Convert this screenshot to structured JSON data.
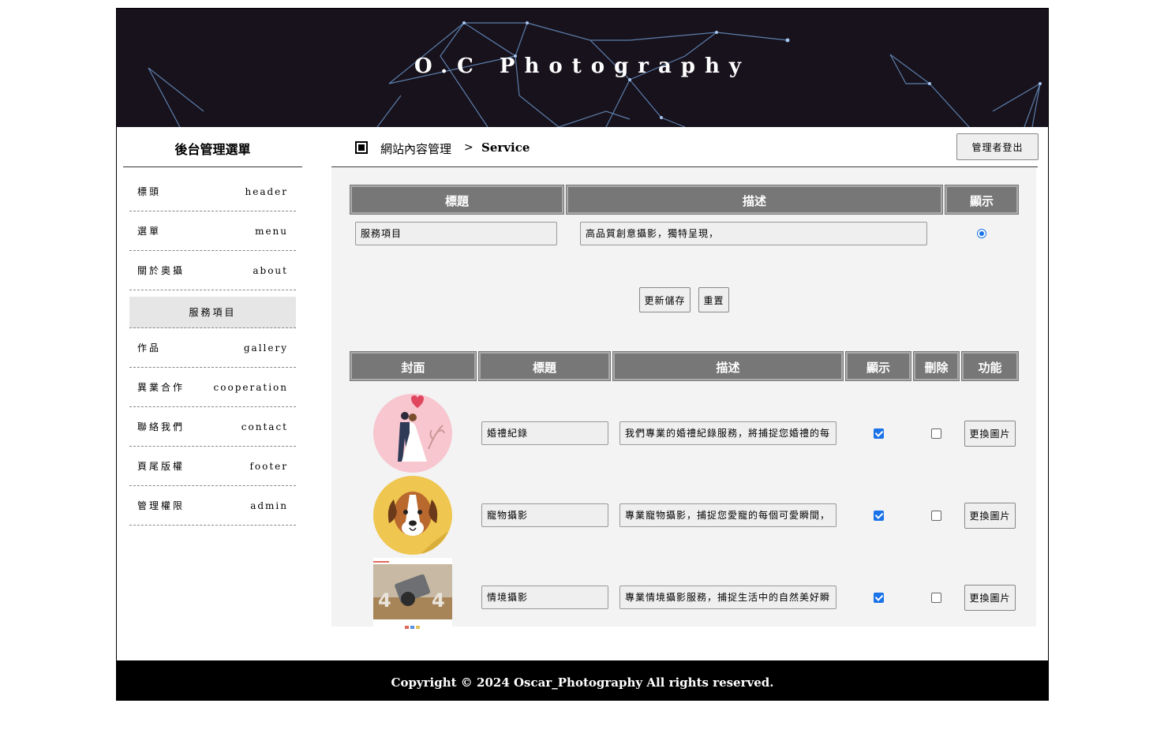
{
  "banner": {
    "title": "O.C Photography"
  },
  "sidebar": {
    "title": "後台管理選單",
    "items": [
      {
        "zh": "標頭",
        "en": "header"
      },
      {
        "zh": "選單",
        "en": "menu"
      },
      {
        "zh": "關於奧攝",
        "en": "about"
      },
      {
        "zh": "服務項目",
        "en": ""
      },
      {
        "zh": "作品",
        "en": "gallery"
      },
      {
        "zh": "異業合作",
        "en": "cooperation"
      },
      {
        "zh": "聯絡我們",
        "en": "contact"
      },
      {
        "zh": "頁尾版權",
        "en": "footer"
      },
      {
        "zh": "管理權限",
        "en": "admin"
      }
    ],
    "active_index": 3
  },
  "breadcrumb": {
    "section": "網站內容管理",
    "separator": ">",
    "current": "Service"
  },
  "logout_label": "管理者登出",
  "header_table": {
    "columns": [
      "標題",
      "描述",
      "顯示"
    ],
    "row": {
      "title": "服務項目",
      "description": "高品質創意攝影，獨特呈現，",
      "shown": true
    }
  },
  "form_buttons": {
    "save": "更新儲存",
    "reset": "重置"
  },
  "items_table": {
    "columns": [
      "封面",
      "標題",
      "描述",
      "顯示",
      "刪除",
      "功能"
    ],
    "rows": [
      {
        "cover": "wedding-couple-image",
        "title": "婚禮紀錄",
        "description": "我們專業的婚禮紀錄服務，將捕捉您婚禮的每",
        "shown": true,
        "delete": false,
        "action": "更換圖片"
      },
      {
        "cover": "dog-face-image",
        "title": "寵物攝影",
        "description": "專業寵物攝影，捕捉您愛寵的每個可愛瞬間，",
        "shown": true,
        "delete": false,
        "action": "更換圖片"
      },
      {
        "cover": "camera-404-image",
        "title": "情境攝影",
        "description": "專業情境攝影服務，捕捉生活中的自然美好瞬",
        "shown": true,
        "delete": false,
        "action": "更換圖片"
      }
    ]
  },
  "footer": {
    "text": "Copyright © 2024 Oscar_Photography All rights reserved."
  },
  "colors": {
    "banner_bg": "#17121c",
    "table_header": "#777777",
    "accent": "#1a73e8",
    "main_bg": "#f3f3f3"
  }
}
